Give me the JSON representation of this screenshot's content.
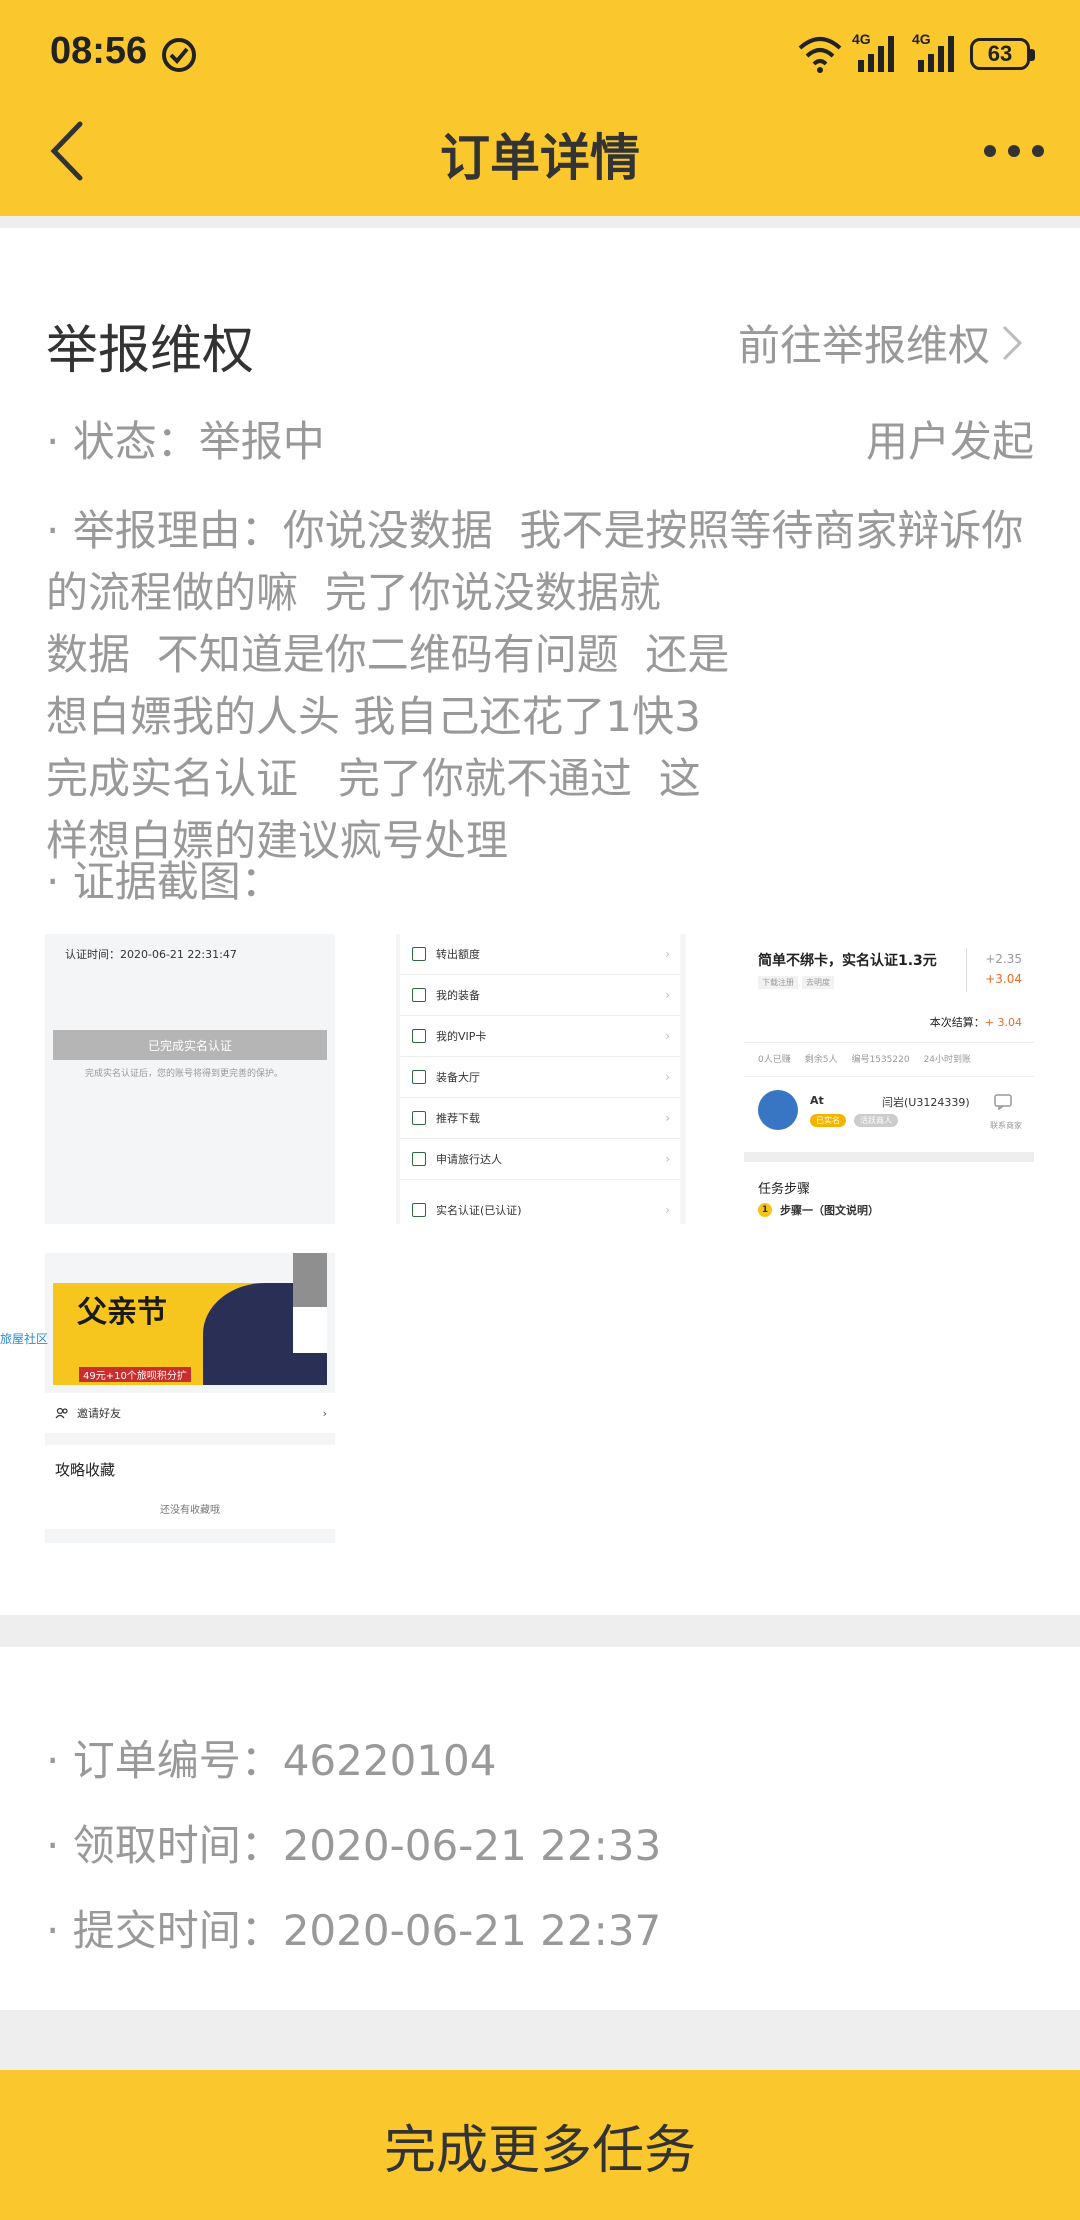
{
  "status_bar": {
    "time": "08:56",
    "net1": "4G",
    "net2": "4G",
    "battery": "63"
  },
  "header": {
    "title": "订单详情"
  },
  "report": {
    "title": "举报维权",
    "goto_link": "前往举报维权",
    "status_label": "· 状态：举报中",
    "initiator": "用户发起",
    "reason": "· 举报理由：你说没数据  我不是按照等待商家辩诉你的流程做的嘛  完了你说没数据就\n数据  不知道是你二维码有问题  还是\n想白嫖我的人头 我自己还花了1快3\n完成实名认证   完了你就不通过  这\n样想白嫖的建议疯号处理",
    "evidence_label": "· 证据截图："
  },
  "screenshots": {
    "s1": {
      "cert_time": "认证时间：2020-06-21 22:31:47",
      "done_button": "已完成实名认证",
      "done_note": "完成实名认证后，您的账号将得到更完善的保护。"
    },
    "s2": {
      "items": [
        "转出额度",
        "我的装备",
        "我的VIP卡",
        "装备大厅",
        "推荐下载",
        "申请旅行达人",
        "实名认证(已认证)"
      ]
    },
    "s3": {
      "title": "简单不绑卡，实名认证1.3元",
      "tag1": "下载注册",
      "tag2": "去明度",
      "price1": "+2.35",
      "price2": "+3.04",
      "settle_label": "本次结算：",
      "settle_value": "+ 3.04",
      "meta1": "0人已赚",
      "meta2": "剩余5人",
      "meta3": "编号1535220",
      "meta4": "24小时到账",
      "at": "At",
      "user": "闫岩(U3124339)",
      "badge1": "已实名",
      "badge2": "活跃商人",
      "contact": "联系商家",
      "steps_title": "任务步骤",
      "step1_num": "1",
      "step1": "步骤一（图文说明）"
    },
    "s4": {
      "banner_title": "父亲节",
      "banner_text": "49元+10个旅呗积分扩",
      "invite": "邀请好友",
      "strategy_title": "攻略收藏",
      "strategy_empty": "还没有收藏哦"
    },
    "community": "旅屋社区"
  },
  "order": {
    "number": "· 订单编号：46220104",
    "receive_time": "· 领取时间：2020-06-21 22:33",
    "submit_time": "· 提交时间：2020-06-21 22:37"
  },
  "bottom": {
    "button": "完成更多任务"
  },
  "colors": {
    "accent": "#fac82c",
    "muted_text": "#999999",
    "orange": "#f06a1f"
  }
}
